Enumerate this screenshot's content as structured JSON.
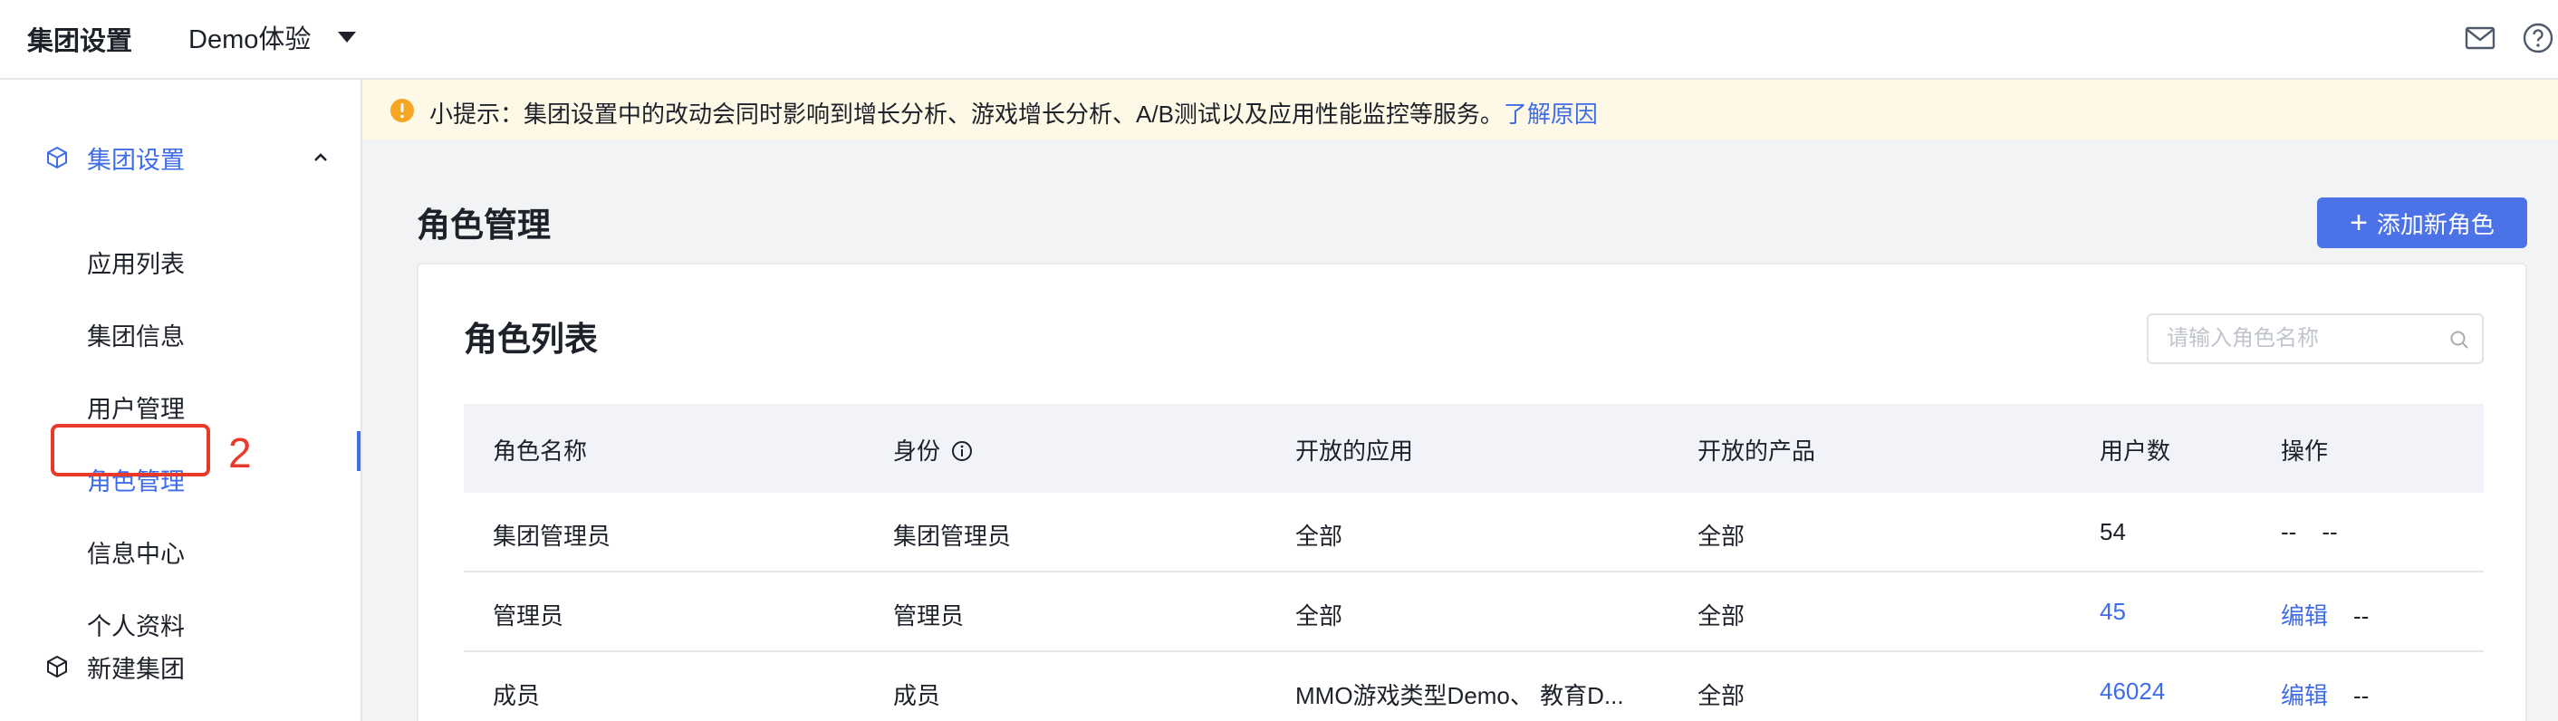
{
  "header": {
    "brand": "集团设置",
    "org_name": "Demo体验"
  },
  "sidebar": {
    "group_settings": "集团设置",
    "items": [
      {
        "label": "应用列表"
      },
      {
        "label": "集团信息"
      },
      {
        "label": "用户管理"
      },
      {
        "label": "角色管理"
      },
      {
        "label": "信息中心"
      },
      {
        "label": "个人资料"
      }
    ],
    "new_group": "新建集团",
    "callout_number": "2"
  },
  "notice": {
    "text": "小提示：集团设置中的改动会同时影响到增长分析、游戏增长分析、A/B测试以及应用性能监控等服务。",
    "link": "了解原因"
  },
  "page": {
    "title": "角色管理",
    "add_button": "添加新角色",
    "add_plus": "+"
  },
  "card": {
    "title": "角色列表",
    "search_placeholder": "请输入角色名称"
  },
  "table": {
    "headers": [
      "角色名称",
      "身份",
      "开放的应用",
      "开放的产品",
      "用户数",
      "操作"
    ],
    "rows": [
      {
        "name": "集团管理员",
        "identity": "集团管理员",
        "apps": "全部",
        "products": "全部",
        "users": "54",
        "op1": "--",
        "op2": "--"
      },
      {
        "name": "管理员",
        "identity": "管理员",
        "apps": "全部",
        "products": "全部",
        "users": "45",
        "op1": "编辑",
        "op2": "--"
      },
      {
        "name": "成员",
        "identity": "成员",
        "apps": "MMO游戏类型Demo、 教育D...",
        "products": "全部",
        "users": "46024",
        "op1": "编辑",
        "op2": "--"
      }
    ]
  },
  "colors": {
    "accent": "#3f6ce8",
    "button": "#4b72e6",
    "callout": "#e8392b",
    "notice_bg": "#fef9e6",
    "warning": "#f5a623"
  },
  "icons": {
    "mail": "mail-icon",
    "help": "help-icon",
    "group": "cube-icon",
    "warning": "warning-icon",
    "search": "search-icon",
    "info": "info-icon"
  }
}
